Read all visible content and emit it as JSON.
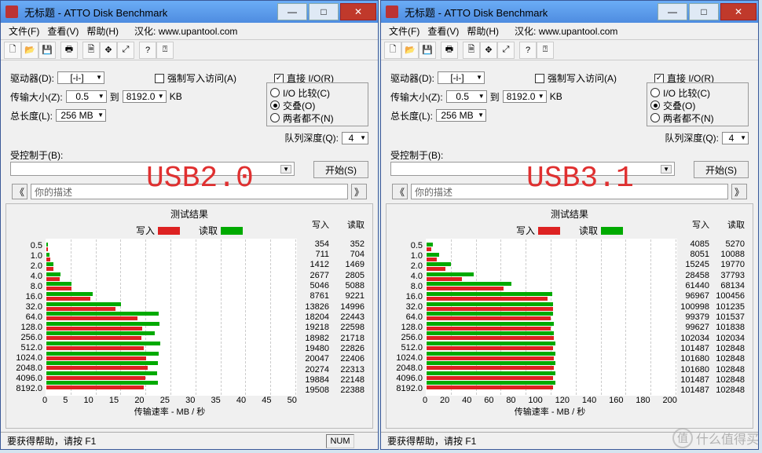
{
  "title": "无标题 - ATTO Disk Benchmark",
  "menu": {
    "file": "文件(F)",
    "view": "查看(V)",
    "help": "帮助(H)",
    "hanhua_label": "汉化:",
    "hanhua_url": "www.upantool.com"
  },
  "winbtns": {
    "min": "—",
    "max": "□",
    "close": "✕"
  },
  "config": {
    "drive_label": "驱动器(D):",
    "drive_value": "[-i-]",
    "force_write_label": "强制写入访问(A)",
    "direct_io_label": "直接 I/O(R)",
    "size_label": "传输大小(Z):",
    "size_from": "0.5",
    "to": "到",
    "size_to": "8192.0",
    "kb": "KB",
    "length_label": "总长度(L):",
    "length_value": "256 MB",
    "opt_compare": "I/O 比较(C)",
    "opt_overlap": "交叠(O)",
    "opt_neither": "两者都不(N)",
    "queue_label": "队列深度(Q):",
    "queue_value": "4"
  },
  "controlled": {
    "label": "受控制于(B):",
    "start_btn": "开始(S)",
    "desc_placeholder": "你的描述"
  },
  "results": {
    "title": "测试结果",
    "write": "写入",
    "read": "读取",
    "axis_label": "传输速率 - MB / 秒"
  },
  "statusbar": {
    "help": "要获得帮助，请按 F1",
    "num": "NUM"
  },
  "overlays": {
    "usb2": "USB2.0",
    "usb3": "USB3.1"
  },
  "watermark": "什么值得买",
  "chart_data": [
    {
      "type": "bar",
      "orientation": "horizontal",
      "categories": [
        "0.5",
        "1.0",
        "2.0",
        "4.0",
        "8.0",
        "16.0",
        "32.0",
        "64.0",
        "128.0",
        "256.0",
        "512.0",
        "1024.0",
        "2048.0",
        "4096.0",
        "8192.0"
      ],
      "series": [
        {
          "name": "写入",
          "values": [
            354,
            711,
            1412,
            2677,
            5046,
            8761,
            13826,
            18204,
            19218,
            18982,
            19480,
            20047,
            20274,
            19884,
            19508
          ]
        },
        {
          "name": "读取",
          "values": [
            352,
            704,
            1469,
            2805,
            5088,
            9221,
            14996,
            22443,
            22598,
            21718,
            22826,
            22406,
            22313,
            22148,
            22388
          ]
        }
      ],
      "xlabel": "传输速率 - MB / 秒",
      "xticks": [
        0,
        5,
        10,
        15,
        20,
        25,
        30,
        35,
        40,
        45,
        50
      ],
      "xlim": [
        0,
        50000
      ],
      "scale_divisor": 1000
    },
    {
      "type": "bar",
      "orientation": "horizontal",
      "categories": [
        "0.5",
        "1.0",
        "2.0",
        "4.0",
        "8.0",
        "16.0",
        "32.0",
        "64.0",
        "128.0",
        "256.0",
        "512.0",
        "1024.0",
        "2048.0",
        "4096.0",
        "8192.0"
      ],
      "series": [
        {
          "name": "写入",
          "values": [
            4085,
            8051,
            15245,
            28458,
            61440,
            96967,
            100998,
            99379,
            99627,
            102034,
            101487,
            101680,
            101680,
            101487,
            101487
          ]
        },
        {
          "name": "读取",
          "values": [
            5270,
            10088,
            19770,
            37793,
            68134,
            100456,
            101235,
            101537,
            101838,
            102034,
            102848,
            102848,
            102848,
            102848,
            102848
          ]
        }
      ],
      "xlabel": "传输速率 - MB / 秒",
      "xticks": [
        0,
        20,
        40,
        60,
        80,
        100,
        120,
        140,
        160,
        180,
        200
      ],
      "xlim": [
        0,
        200000
      ],
      "scale_divisor": 1000
    }
  ]
}
